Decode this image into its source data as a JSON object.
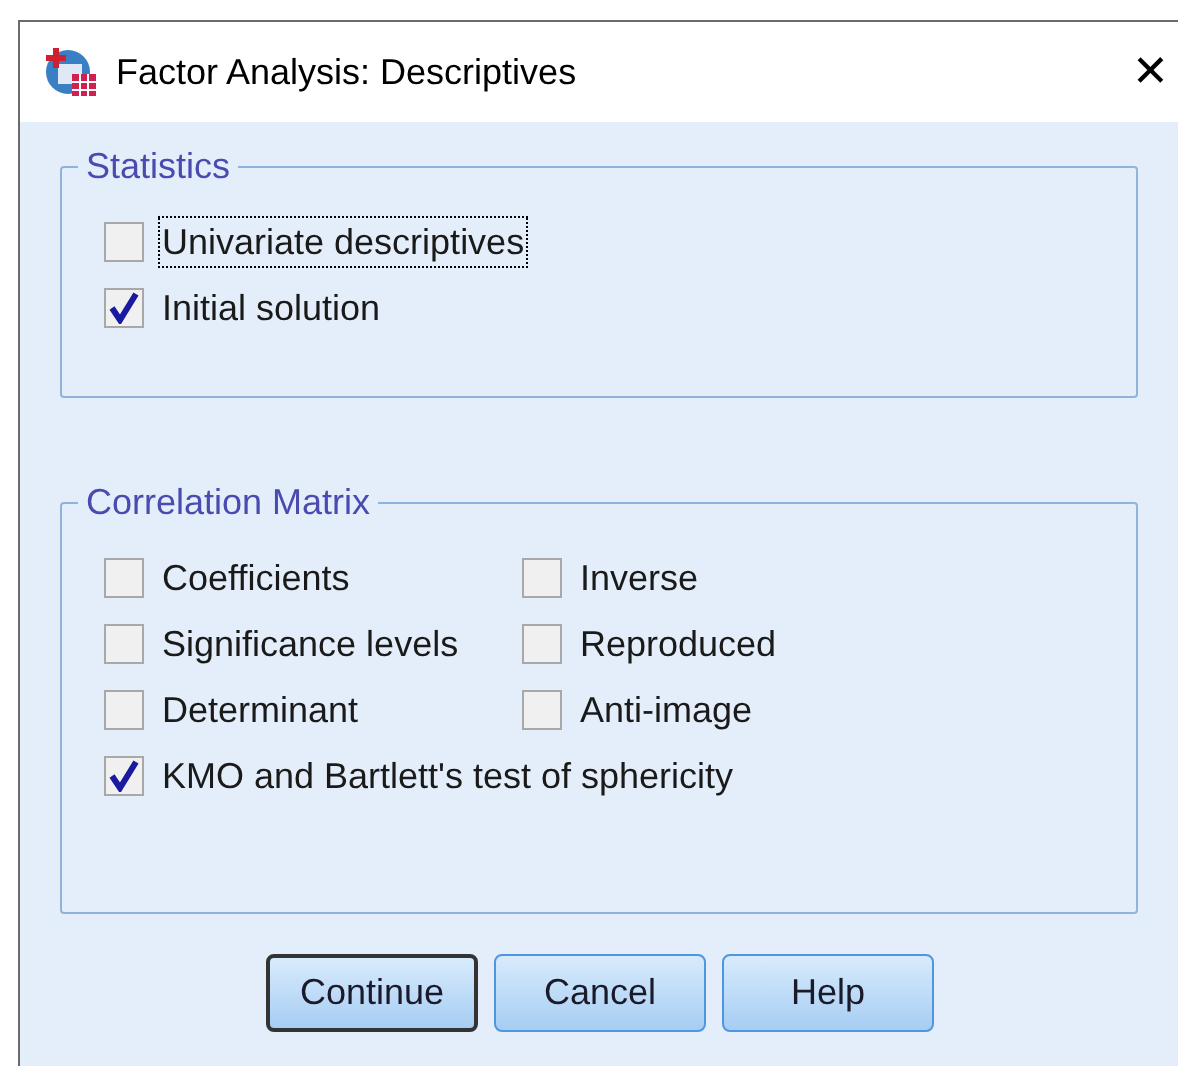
{
  "window": {
    "title": "Factor Analysis: Descriptives",
    "close": "✕"
  },
  "groups": [
    {
      "title": "Statistics",
      "options": [
        {
          "label": "Univariate descriptives",
          "checked": false,
          "focused": true
        },
        {
          "label": "Initial solution",
          "checked": true,
          "focused": false
        }
      ]
    },
    {
      "title": "Correlation Matrix",
      "options": [
        {
          "label": "Coefficients",
          "checked": false,
          "focused": false
        },
        {
          "label": "Inverse",
          "checked": false,
          "focused": false
        },
        {
          "label": "Significance levels",
          "checked": false,
          "focused": false
        },
        {
          "label": "Reproduced",
          "checked": false,
          "focused": false
        },
        {
          "label": "Determinant",
          "checked": false,
          "focused": false
        },
        {
          "label": "Anti-image",
          "checked": false,
          "focused": false
        },
        {
          "label": "KMO and Bartlett's test of sphericity",
          "checked": true,
          "focused": false
        }
      ]
    }
  ],
  "buttons": [
    {
      "label": "Continue",
      "default": true
    },
    {
      "label": "Cancel",
      "default": false
    },
    {
      "label": "Help",
      "default": false
    }
  ]
}
